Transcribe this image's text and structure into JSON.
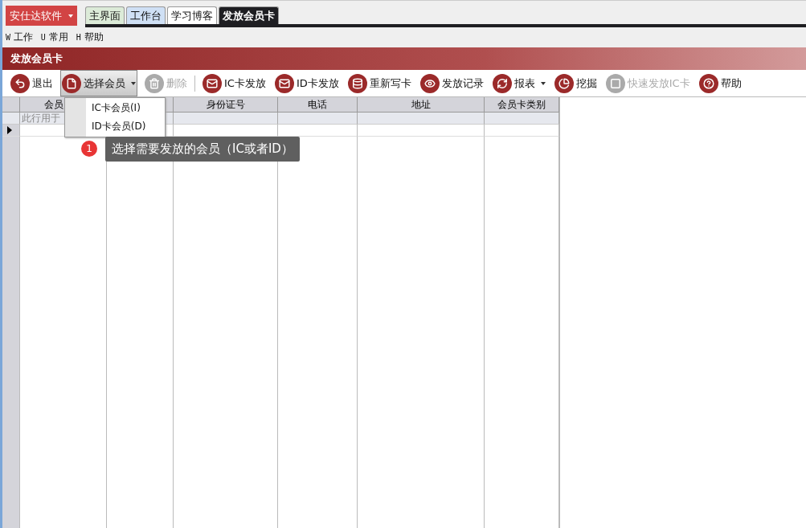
{
  "app_menu": {
    "label": "安仕达软件"
  },
  "tabs": [
    {
      "label": "主界面",
      "selected": false,
      "color": "#dcebd8"
    },
    {
      "label": "工作台",
      "selected": false,
      "color": "#cfe0f5"
    },
    {
      "label": "学习博客",
      "selected": false,
      "color": "#ffffff"
    },
    {
      "label": "发放会员卡",
      "selected": true,
      "color": "#1e1e22"
    }
  ],
  "menu": [
    {
      "key": "W",
      "label": "工作"
    },
    {
      "key": "U",
      "label": "常用"
    },
    {
      "key": "H",
      "label": "帮助"
    }
  ],
  "panel_title": "发放会员卡",
  "toolbar": [
    {
      "kind": "button",
      "label": "退出",
      "disabled": false
    },
    {
      "kind": "dropdown",
      "label": "选择会员",
      "disabled": false,
      "pressed": true
    },
    {
      "kind": "button",
      "label": "删除",
      "disabled": true
    },
    {
      "kind": "separator"
    },
    {
      "kind": "button",
      "label": "IC卡发放",
      "disabled": false
    },
    {
      "kind": "button",
      "label": "ID卡发放",
      "disabled": false
    },
    {
      "kind": "button",
      "label": "重新写卡",
      "disabled": false
    },
    {
      "kind": "button",
      "label": "发放记录",
      "disabled": false
    },
    {
      "kind": "dropdown",
      "label": "报表",
      "disabled": false,
      "pressed": false
    },
    {
      "kind": "button",
      "label": "挖掘",
      "disabled": false
    },
    {
      "kind": "button",
      "label": "快速发放IC卡",
      "disabled": true
    },
    {
      "kind": "button",
      "label": "帮助",
      "disabled": false
    }
  ],
  "table": {
    "columns": [
      {
        "label": "会员"
      },
      {},
      {
        "label": "身份证号"
      },
      {
        "label": "电话"
      },
      {
        "label": "地址"
      },
      {
        "label": "会员卡类别"
      }
    ],
    "filter_hint": "此行用于"
  },
  "dropdown_menu": [
    {
      "label": "IC卡会员(I)"
    },
    {
      "label": "ID卡会员(D)"
    }
  ],
  "hint": {
    "badge": "1",
    "text": "选择需要发放的会员（IC或者ID）"
  }
}
